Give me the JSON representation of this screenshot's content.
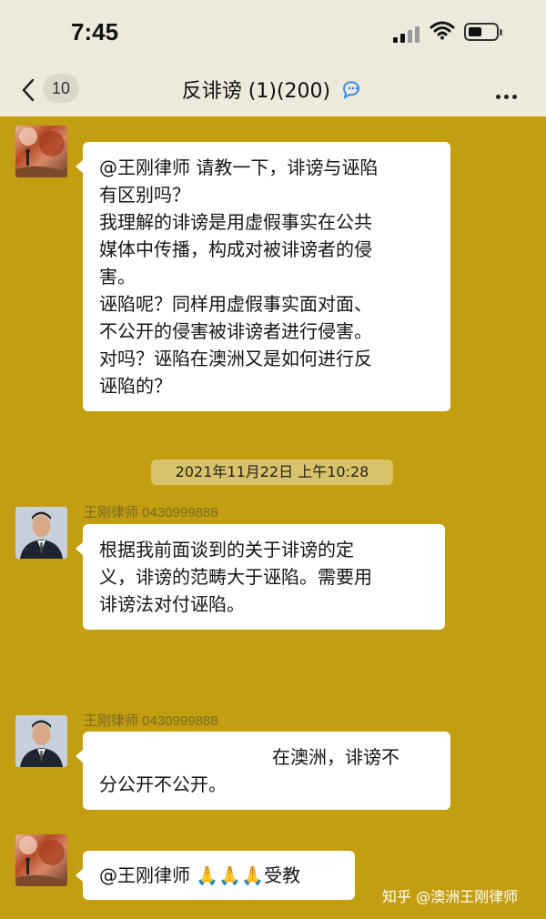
{
  "status_bar": {
    "time": "7:45"
  },
  "nav": {
    "back_count": "10",
    "title": "反诽谤 (1)(200)"
  },
  "messages": {
    "m1": {
      "lines": [
        "@王刚律师 请教一下，诽谤与诬陷",
        "有区别吗？",
        "我理解的诽谤是用虚假事实在公共",
        "媒体中传播，构成对被诽谤者的侵",
        "害。",
        "诬陷呢？同样用虚假事实面对面、",
        "不公开的侵害被诽谤者进行侵害。",
        "对吗？诬陷在澳洲又是如何进行反",
        "诬陷的？"
      ]
    },
    "timestamp": "2021年11月22日 上午10:28",
    "m2": {
      "sender": "王刚律师 0430999888",
      "lines": [
        "根据我前面谈到的关于诽谤的定",
        "义，诽谤的范畴大于诬陷。需要用",
        "诽谤法对付诬陷。"
      ]
    },
    "m3": {
      "sender": "王刚律师 0430999888",
      "lines": [
        "在澳洲，诽谤不",
        "分公开不公开。"
      ]
    },
    "m4": {
      "mention": "@王刚律师",
      "emoji": "🙏🙏🙏",
      "text": "受教"
    }
  },
  "watermark": "知乎 @澳洲王刚律师",
  "colors": {
    "chat_background": "#c39e10",
    "bar_background": "#ede9dc",
    "bubble": "#ffffff"
  }
}
